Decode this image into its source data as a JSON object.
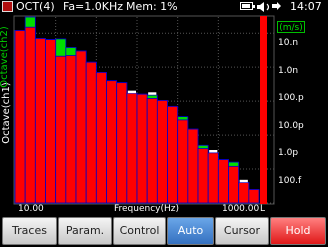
{
  "topbar": {
    "mode": "OCT(4)",
    "rate": "Fa=1.0KHz",
    "memory": "Mem: 1%",
    "time": "14:07",
    "status_icons": [
      "battery-icon",
      "speaker-icon",
      "arrow-icon"
    ]
  },
  "plot": {
    "y_label_ch1": "Octave(ch1)",
    "y_label_ch2": "Octave(ch2)",
    "unit": "(m/s)",
    "y_ticks": [
      "10.n",
      "1.0n",
      "100.p",
      "10.0p",
      "1.0p",
      "100.f"
    ],
    "x_label": "Frequency(Hz)",
    "x_start": "10.00",
    "x_end": "1000.00",
    "x_suffix": "L",
    "colors": {
      "ch1": "#ff0000",
      "ch2": "#00dd00",
      "edge": "#0000cc",
      "grid": "#555555"
    }
  },
  "chart_data": {
    "type": "bar",
    "xlabel": "Frequency(Hz)",
    "ylabel": "",
    "y_scale": "log",
    "ylim": [
      1e-13,
      3e-08
    ],
    "x_range": [
      10.0,
      1000.0
    ],
    "series": [
      {
        "name": "Octave(ch1)",
        "values": [
          1.2e-08,
          1.5e-08,
          7e-09,
          6.5e-09,
          2.1e-09,
          2.2e-09,
          3e-09,
          1.4e-09,
          7e-10,
          4e-10,
          3.5e-10,
          1.7e-10,
          1.6e-10,
          1.2e-10,
          1.05e-10,
          7e-11,
          2.8e-11,
          1.5e-11,
          4e-12,
          3e-12,
          1.9e-12,
          1.2e-12,
          4e-13,
          2.5e-13
        ]
      },
      {
        "name": "Octave(ch2)",
        "values": [
          1.2e-08,
          3e-08,
          7e-09,
          6.5e-09,
          6.8e-09,
          3.8e-09,
          3e-09,
          1.4e-09,
          7e-10,
          4e-10,
          3.5e-10,
          1.7e-10,
          1.6e-10,
          1.5e-10,
          1.05e-10,
          7e-11,
          3.5e-11,
          1.5e-11,
          5e-12,
          3e-12,
          1.9e-12,
          1.6e-12,
          4e-13,
          2.5e-13
        ]
      },
      {
        "name": "peak",
        "values": [
          null,
          null,
          null,
          null,
          null,
          null,
          null,
          null,
          null,
          null,
          null,
          1.9e-10,
          null,
          1.7e-10,
          null,
          null,
          null,
          null,
          null,
          3.4e-12,
          null,
          null,
          4.5e-13,
          null
        ]
      }
    ]
  },
  "softkeys": [
    {
      "label": "Traces",
      "style": "normal"
    },
    {
      "label": "Param.",
      "style": "normal"
    },
    {
      "label": "Control",
      "style": "normal"
    },
    {
      "label": "Auto",
      "style": "active"
    },
    {
      "label": "Cursor",
      "style": "normal"
    },
    {
      "label": "Hold",
      "style": "hold"
    }
  ]
}
